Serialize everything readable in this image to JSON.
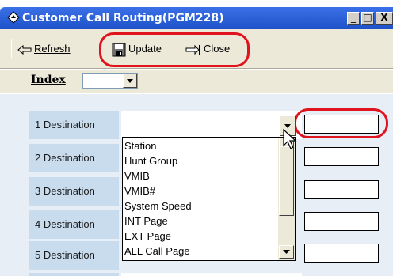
{
  "window": {
    "title": "Customer Call Routing(PGM228)",
    "controls": {
      "minimize": "_",
      "maximize": "□",
      "close": "X"
    }
  },
  "toolbar": {
    "refresh_label": "Refresh",
    "update_label": "Update",
    "close_label": "Close"
  },
  "index": {
    "label": "Index",
    "value": ""
  },
  "rows": [
    {
      "label": "1 Destination"
    },
    {
      "label": "2 Destination"
    },
    {
      "label": "3 Destination"
    },
    {
      "label": "4 Destination"
    },
    {
      "label": "5 Destination"
    }
  ],
  "dropdown": {
    "options": [
      "Station",
      "Hunt Group",
      "VMIB",
      "VMIB#",
      "System Speed",
      "INT Page",
      "EXT Page",
      "ALL Call Page"
    ]
  },
  "colors": {
    "highlight": "#e0141e",
    "titlebar": "#1f52c8",
    "label_bg": "#c9dcee"
  }
}
